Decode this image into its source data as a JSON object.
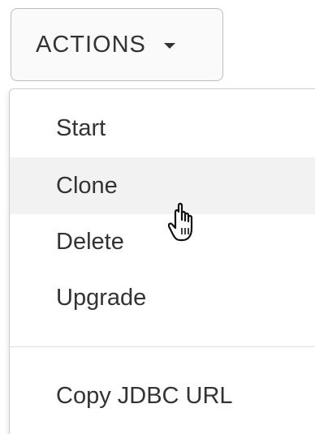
{
  "actions_button": {
    "label": "ACTIONS",
    "caret_icon": "caret-down-icon"
  },
  "menu": {
    "items": [
      {
        "label": "Start"
      },
      {
        "label": "Clone",
        "hovered": true
      },
      {
        "label": "Delete"
      },
      {
        "label": "Upgrade"
      }
    ],
    "secondary_items": [
      {
        "label": "Copy JDBC URL"
      }
    ]
  },
  "cursor": {
    "icon": "hand-pointer-icon"
  }
}
